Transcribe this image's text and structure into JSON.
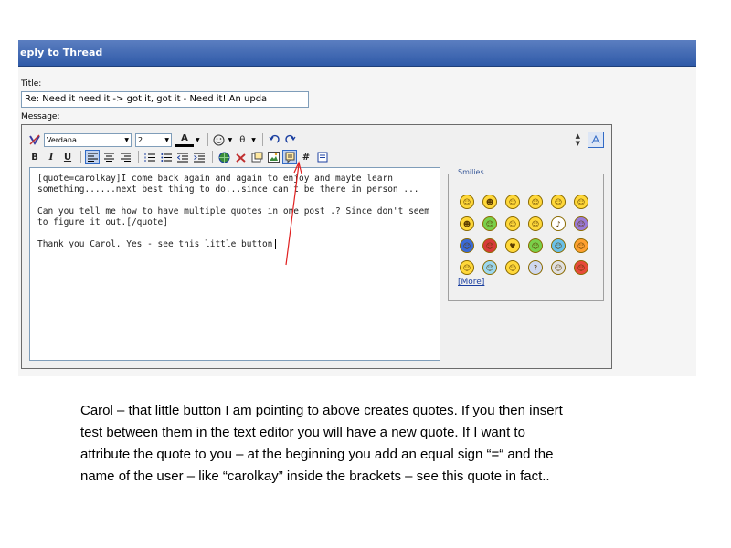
{
  "window": {
    "title": "eply to Thread"
  },
  "form": {
    "title_label": "Title:",
    "title_value": "Re: Need it need it -> got it, got it - Need it!  An upda",
    "message_label": "Message:"
  },
  "toolbar": {
    "font_value": "Verdana",
    "size_value": "2",
    "bold": "B",
    "italic": "I",
    "underline": "U",
    "font_color": "A",
    "theta": "θ",
    "hash": "#"
  },
  "message_lines": [
    "[quote=carolkay]I come back again and again to enjoy and maybe learn",
    "something......next best thing to do...since can't be there in person ...",
    "",
    "Can you tell me how to have multiple quotes in one post .? Since don't seem",
    "to figure it out.[/quote]",
    "",
    "Thank you Carol.  Yes - see this little button"
  ],
  "smilies": {
    "legend": "Smilies",
    "more_link": "[More]",
    "icons": [
      "biggrin-icon",
      "cool-icon",
      "smile-icon",
      "rock-icon",
      "happy-icon",
      "confused-icon",
      "laugh-icon",
      "sick-icon",
      "clap-icon",
      "group-icon",
      "music-icon",
      "purple-icon",
      "blue-icon",
      "devil-icon",
      "love-icon",
      "helmet-icon",
      "wink-icon",
      "angry-icon",
      "shades-icon",
      "cold-icon",
      "eek-icon",
      "question-icon",
      "shock-icon",
      "mad-icon"
    ]
  },
  "caption_lines": [
    "Carol – that little button I am pointing to above creates quotes.  If you then insert",
    "test between them in the text editor you will have a new quote.  If I want to",
    "attribute the quote to you – at the beginning you add an equal sign “=“ and the",
    "name of the user – like “carolkay” inside the brackets – see this quote in fact.."
  ],
  "colors": {
    "titlebar": "#2f5aa8",
    "arrow": "#e02020",
    "link": "#1b3fa0"
  }
}
